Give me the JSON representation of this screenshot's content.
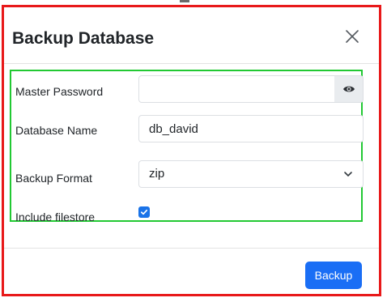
{
  "dialog": {
    "title": "Backup Database"
  },
  "form": {
    "master_password": {
      "label": "Master Password",
      "value": ""
    },
    "database_name": {
      "label": "Database Name",
      "value": "db_david"
    },
    "backup_format": {
      "label": "Backup Format",
      "selected": "zip"
    },
    "include_filestore": {
      "label": "Include filestore",
      "checked": true
    }
  },
  "footer": {
    "backup_label": "Backup"
  },
  "colors": {
    "primary": "#1a6ef5",
    "outer_highlight": "#e8191a",
    "form_highlight": "#22c933"
  },
  "icons": {
    "close": "close-icon",
    "eye": "eye-icon",
    "chevron": "chevron-down-icon",
    "check": "check-icon"
  }
}
